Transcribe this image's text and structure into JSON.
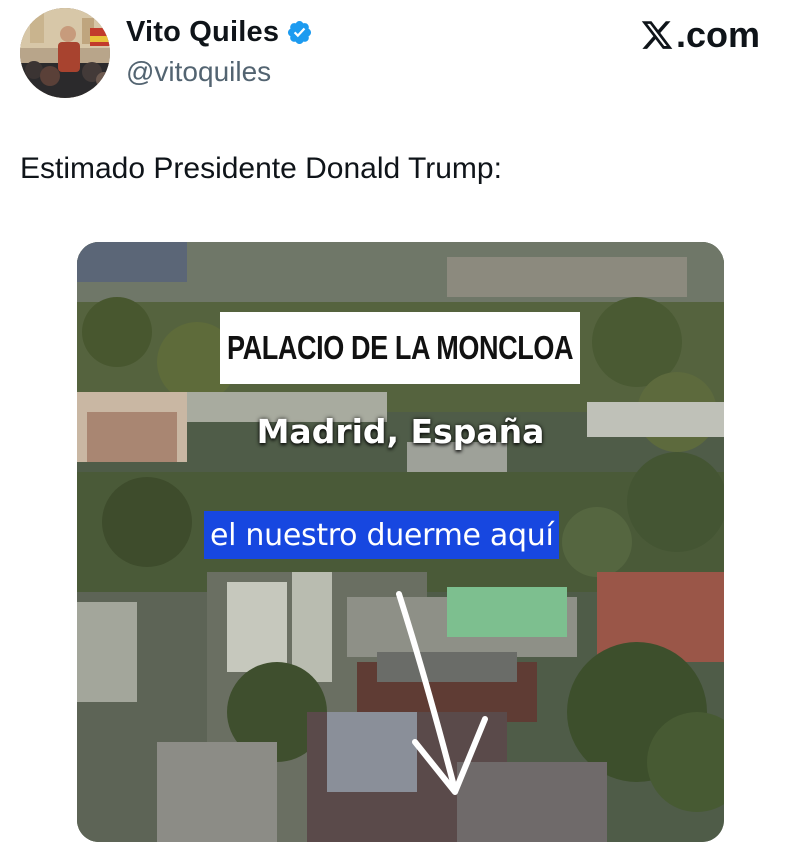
{
  "tweet": {
    "author": {
      "display_name": "Vito Quiles",
      "handle": "@vitoquiles",
      "verified": true,
      "avatar": "profile-photo"
    },
    "brand": "X.com",
    "text": "Estimado Presidente Donald Trump:",
    "media": {
      "title_label": "PALACIO DE LA MONCLOA",
      "location_label": "Madrid, España",
      "caption_label": "el nuestro duerme aquí",
      "arrow_icon": "down-arrow-icon"
    }
  },
  "colors": {
    "verified_badge": "#1d9bf0",
    "handle_text": "#536471",
    "caption_background": "#1747e0"
  }
}
